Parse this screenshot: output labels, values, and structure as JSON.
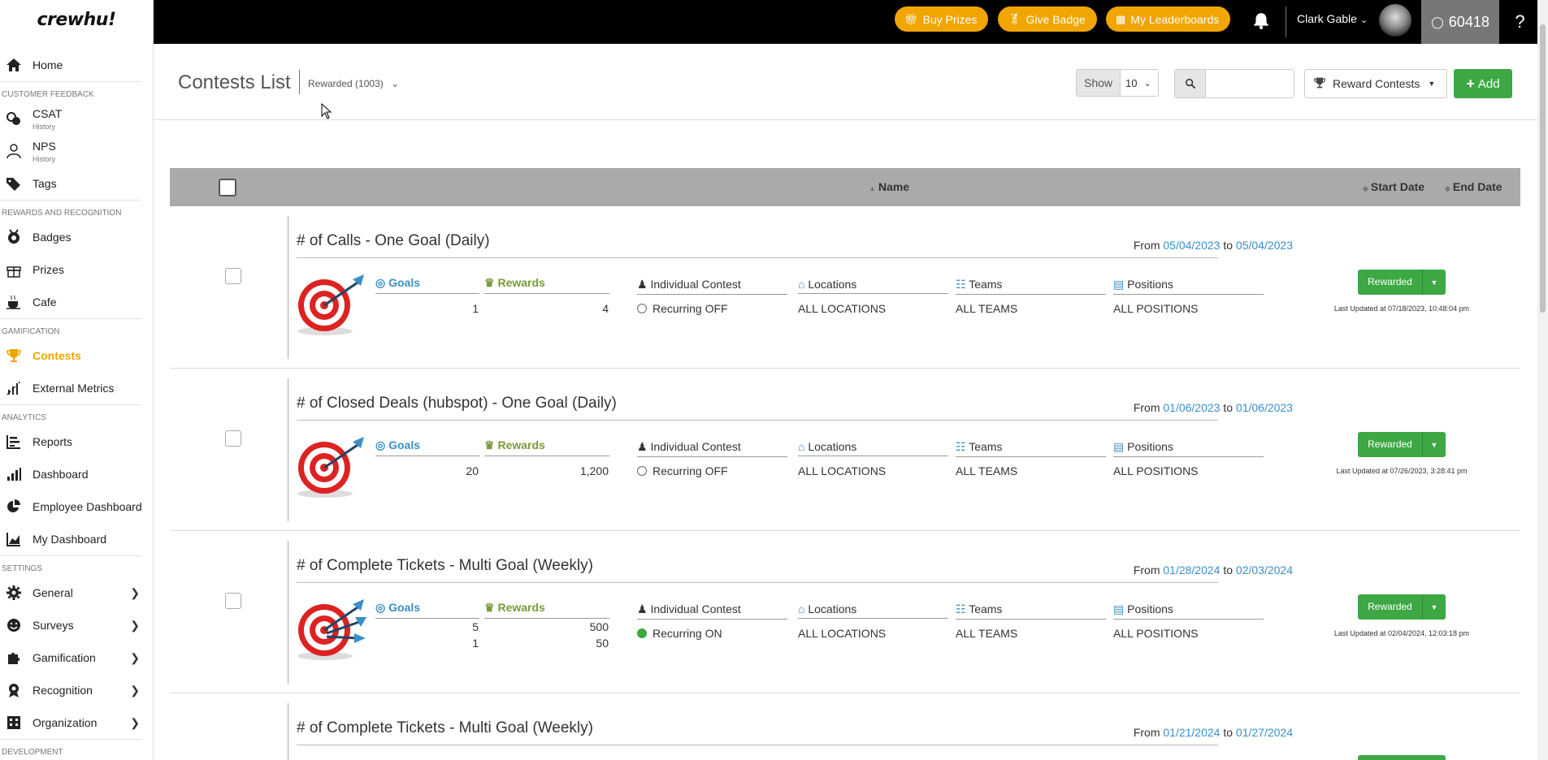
{
  "sidebar": {
    "logo": "crewhu!",
    "items": {
      "home": "Home",
      "sec_feedback": "CUSTOMER FEEDBACK",
      "csat": "CSAT",
      "csat_sub": "History",
      "nps": "NPS",
      "nps_sub": "History",
      "tags": "Tags",
      "sec_rewards": "REWARDS AND RECOGNITION",
      "badges": "Badges",
      "prizes": "Prizes",
      "cafe": "Cafe",
      "sec_gamification": "GAMIFICATION",
      "contests": "Contests",
      "external_metrics": "External Metrics",
      "sec_analytics": "ANALYTICS",
      "reports": "Reports",
      "dashboard": "Dashboard",
      "employee_dashboard": "Employee Dashboard",
      "my_dashboard": "My Dashboard",
      "sec_settings": "SETTINGS",
      "general": "General",
      "surveys": "Surveys",
      "gamification": "Gamification",
      "recognition": "Recognition",
      "organization": "Organization",
      "sec_development": "DEVELOPMENT"
    }
  },
  "topbar": {
    "buy_prizes": "Buy Prizes",
    "give_badge": "Give Badge",
    "my_leaderboards": "My Leaderboards",
    "user_name": "Clark Gable",
    "points": "60418",
    "help": "?",
    "accent": "#f0a500"
  },
  "header": {
    "title": "Contests List",
    "filter": "Rewarded (1003)",
    "show_label": "Show",
    "show_value": "10",
    "search_placeholder": "",
    "reward_contests": "Reward Contests",
    "add": "Add"
  },
  "table": {
    "col_name": "Name",
    "col_start": "Start Date",
    "col_end": "End Date"
  },
  "labels": {
    "from": "From",
    "to": "to",
    "goals": "Goals",
    "rewards": "Rewards",
    "individual": "Individual Contest",
    "locations": "Locations",
    "teams": "Teams",
    "positions": "Positions",
    "all_locations": "ALL LOCATIONS",
    "all_teams": "ALL TEAMS",
    "all_positions": "ALL POSITIONS",
    "status": "Rewarded"
  },
  "rows": [
    {
      "name": "# of Calls - One Goal (Daily)",
      "start": "05/04/2023",
      "end": "05/04/2023",
      "goals": [
        "1"
      ],
      "rewards": [
        "4"
      ],
      "recurring": "Recurring OFF",
      "updated": "Last Updated at 07/18/2023, 10:48:04 pm"
    },
    {
      "name": "# of Closed Deals (hubspot) - One Goal (Daily)",
      "start": "01/06/2023",
      "end": "01/06/2023",
      "goals": [
        "20"
      ],
      "rewards": [
        "1,200"
      ],
      "recurring": "Recurring OFF",
      "updated": "Last Updated at 07/26/2023, 3:28:41 pm"
    },
    {
      "name": "# of Complete Tickets - Multi Goal (Weekly)",
      "start": "01/28/2024",
      "end": "02/03/2024",
      "goals": [
        "5",
        "1"
      ],
      "rewards": [
        "500",
        "50"
      ],
      "recurring": "Recurring ON",
      "updated": "Last Updated at 02/04/2024, 12:03:18 pm"
    },
    {
      "name": "# of Complete Tickets - Multi Goal (Weekly)",
      "start": "01/21/2024",
      "end": "01/27/2024"
    }
  ]
}
